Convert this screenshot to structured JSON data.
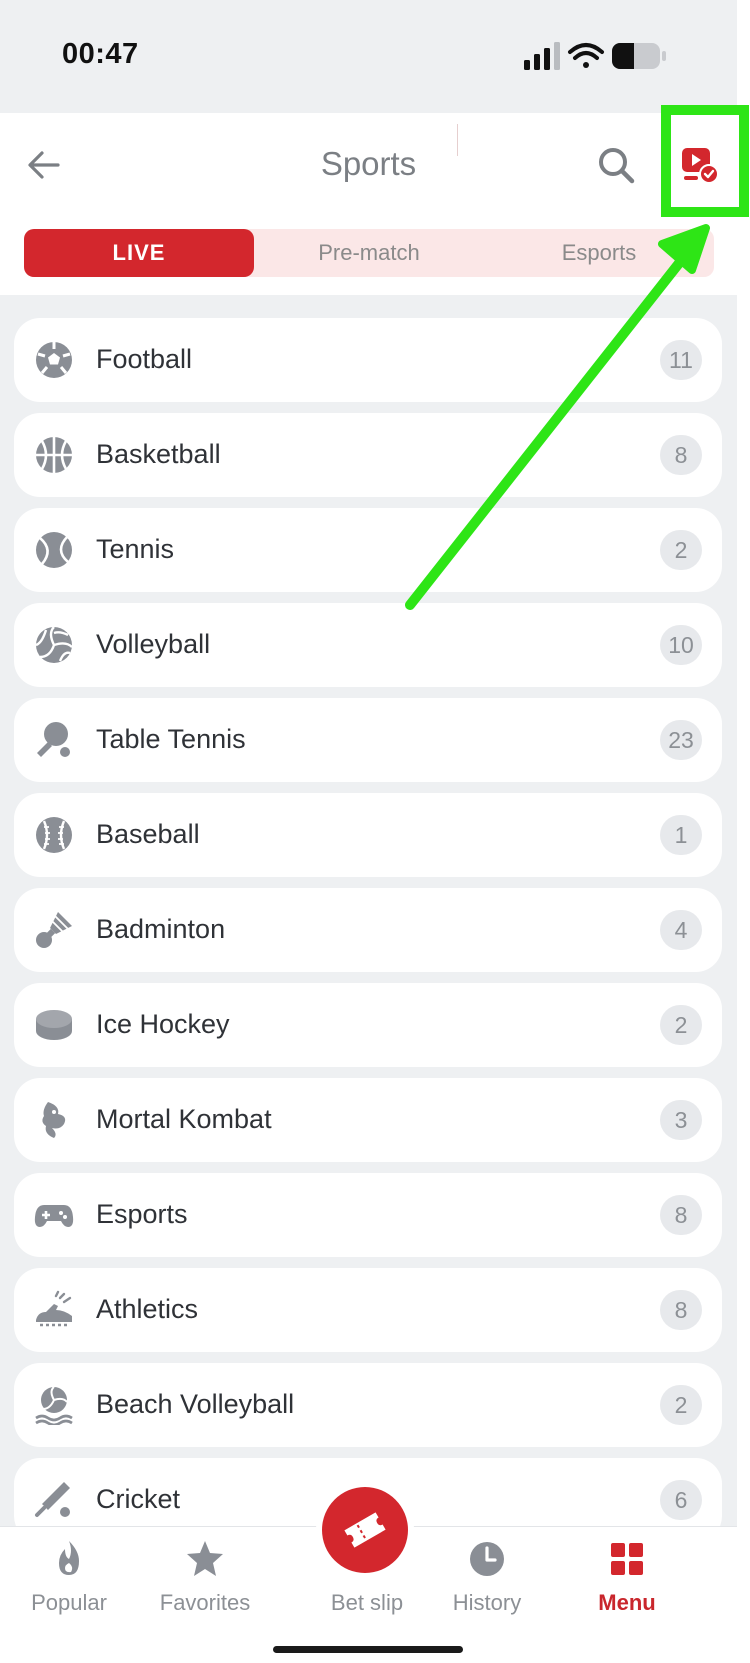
{
  "status_bar": {
    "time": "00:47"
  },
  "header": {
    "title": "Sports",
    "tabs": [
      {
        "label": "LIVE",
        "active": true
      },
      {
        "label": "Pre-match",
        "active": false
      },
      {
        "label": "Esports",
        "active": false
      }
    ]
  },
  "sports": [
    {
      "name": "Football",
      "count": "11",
      "icon": "football-icon"
    },
    {
      "name": "Basketball",
      "count": "8",
      "icon": "basketball-icon"
    },
    {
      "name": "Tennis",
      "count": "2",
      "icon": "tennis-ball-icon"
    },
    {
      "name": "Volleyball",
      "count": "10",
      "icon": "volleyball-icon"
    },
    {
      "name": "Table Tennis",
      "count": "23",
      "icon": "table-tennis-icon"
    },
    {
      "name": "Baseball",
      "count": "1",
      "icon": "baseball-icon"
    },
    {
      "name": "Badminton",
      "count": "4",
      "icon": "shuttlecock-icon"
    },
    {
      "name": "Ice Hockey",
      "count": "2",
      "icon": "hockey-puck-icon"
    },
    {
      "name": "Mortal Kombat",
      "count": "3",
      "icon": "dragon-icon"
    },
    {
      "name": "Esports",
      "count": "8",
      "icon": "gamepad-icon"
    },
    {
      "name": "Athletics",
      "count": "8",
      "icon": "running-shoe-icon"
    },
    {
      "name": "Beach Volleyball",
      "count": "2",
      "icon": "beach-volleyball-icon"
    },
    {
      "name": "Cricket",
      "count": "6",
      "icon": "cricket-bat-icon"
    }
  ],
  "bottom_nav": {
    "popular": "Popular",
    "favorites": "Favorites",
    "bet_slip": "Bet slip",
    "history": "History",
    "menu": "Menu"
  },
  "colors": {
    "accent": "#d3272d",
    "highlight": "#2ee516",
    "icon_gray": "#8a8e95"
  }
}
